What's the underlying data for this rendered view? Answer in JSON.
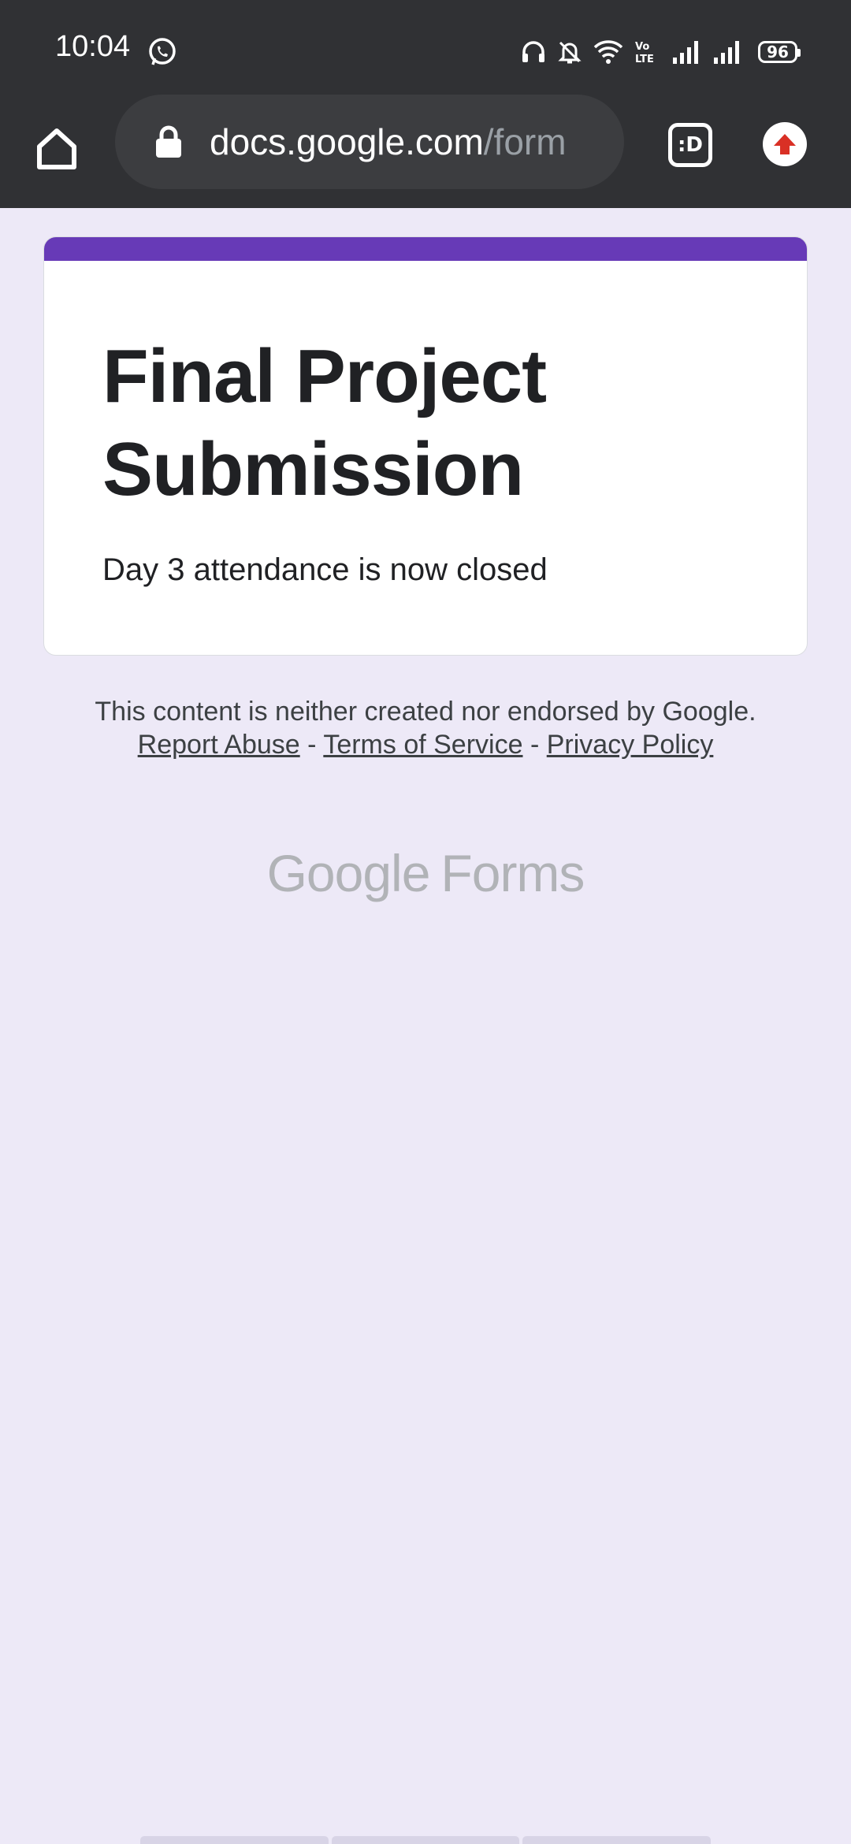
{
  "status_bar": {
    "time": "10:04",
    "battery": "96",
    "icons": [
      "whatsapp-icon",
      "headphones-icon",
      "bell-off-icon",
      "wifi-icon",
      "volte-icon",
      "signal-icon",
      "signal-icon"
    ]
  },
  "browser": {
    "url_host": "docs.google.com",
    "url_path": "/form",
    "tabs_label": ":D",
    "icons": [
      "home-icon",
      "lock-icon",
      "tabs-icon",
      "update-icon"
    ]
  },
  "form": {
    "title": "Final Project Submission",
    "message": "Day 3 attendance is now closed",
    "accent_color": "#673ab7"
  },
  "footer": {
    "disclaimer_text": "This content is neither created nor endorsed by Google.",
    "report_abuse": "Report Abuse",
    "separator": "-",
    "terms": "Terms of Service",
    "privacy": "Privacy Policy",
    "logo_google": "Google",
    "logo_forms": "Forms"
  },
  "colors": {
    "page_background": "#ede9f7",
    "chrome_background": "#303134",
    "update_icon_color": "#d93025"
  }
}
